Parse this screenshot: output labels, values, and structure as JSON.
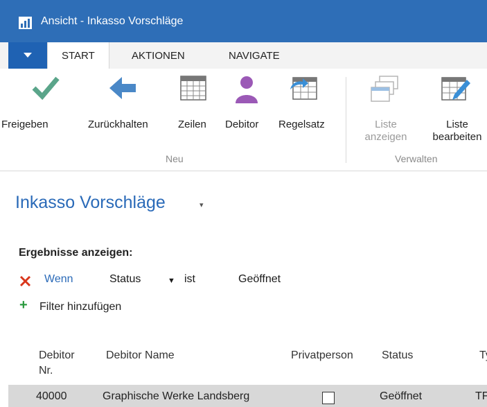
{
  "window": {
    "title": "Ansicht - Inkasso Vorschläge"
  },
  "tabs": [
    {
      "label": "START",
      "active": true
    },
    {
      "label": "AKTIONEN",
      "active": false
    },
    {
      "label": "NAVIGATE",
      "active": false
    }
  ],
  "ribbon": {
    "groups": [
      {
        "label": "Neu",
        "buttons": [
          {
            "label": "Freigeben",
            "icon": "checkmark-icon"
          },
          {
            "label": "Zurückhalten",
            "icon": "arrow-left-icon"
          },
          {
            "label": "Zeilen",
            "icon": "grid-icon"
          },
          {
            "label": "Debitor",
            "icon": "person-icon"
          },
          {
            "label": "Regelsatz",
            "icon": "grid-arrow-icon"
          }
        ]
      },
      {
        "label": "Verwalten",
        "buttons": [
          {
            "label_line1": "Liste",
            "label_line2": "anzeigen",
            "icon": "view-list-icon",
            "disabled": true
          },
          {
            "label_line1": "Liste",
            "label_line2": "bearbeiten",
            "icon": "edit-list-icon",
            "disabled": false
          }
        ]
      }
    ]
  },
  "page": {
    "title": "Inkasso Vorschläge"
  },
  "filters": {
    "heading": "Ergebnisse anzeigen:",
    "rows": [
      {
        "keyword": "Wenn",
        "field": "Status",
        "operator": "ist",
        "value": "Geöffnet"
      }
    ],
    "add_label": "Filter hinzufügen"
  },
  "table": {
    "columns": {
      "debitor_nr_line1": "Debitor",
      "debitor_nr_line2": "Nr.",
      "debitor_name": "Debitor Name",
      "privatperson": "Privatperson",
      "status": "Status",
      "typ": "Ty"
    },
    "rows": [
      {
        "debitor_nr": "40000",
        "debitor_name": "Graphische Werke Landsberg",
        "privatperson": false,
        "status": "Geöffnet",
        "typ": "TF"
      }
    ]
  },
  "colors": {
    "titlebar": "#2e6eb7",
    "accent": "#2a6ab8",
    "checkmark": "#5aa58a",
    "arrow": "#4a88c7",
    "person": "#9b59b6"
  }
}
